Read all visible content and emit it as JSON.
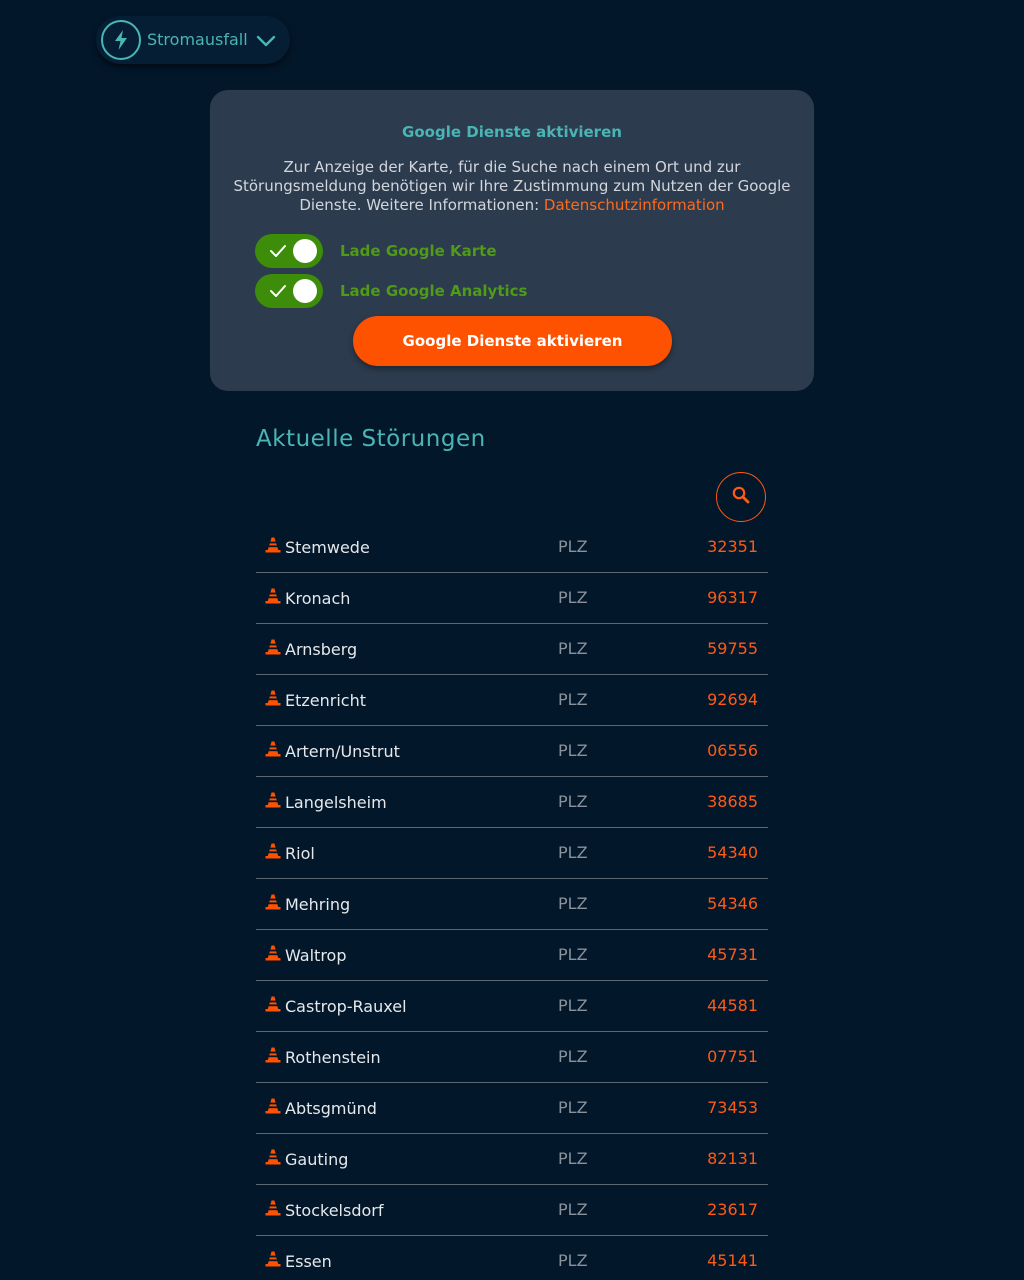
{
  "header": {
    "category_label": "Stromausfall",
    "category_icon": "lightning-bolt-icon",
    "dropdown_icon": "chevron-down-icon"
  },
  "consent": {
    "title": "Google Dienste aktivieren",
    "text": "Zur Anzeige der Karte, für die Suche nach einem Ort und zur Störungsmeldung benötigen wir Ihre Zustimmung zum Nutzen der Google Dienste. Weitere Informationen: ",
    "link_text": "Datenschutzinformation",
    "toggles": [
      {
        "label": "Lade Google Karte",
        "checked": true
      },
      {
        "label": "Lade Google Analytics",
        "checked": true
      }
    ],
    "button_label": "Google Dienste aktivieren"
  },
  "outages": {
    "title": "Aktuelle Störungen",
    "search_icon": "search-icon",
    "plz_label": "PLZ",
    "items": [
      {
        "town": "Stemwede",
        "plz": "32351"
      },
      {
        "town": "Kronach",
        "plz": "96317"
      },
      {
        "town": "Arnsberg",
        "plz": "59755"
      },
      {
        "town": "Etzenricht",
        "plz": "92694"
      },
      {
        "town": "Artern/Unstrut",
        "plz": "06556"
      },
      {
        "town": "Langelsheim",
        "plz": "38685"
      },
      {
        "town": "Riol",
        "plz": "54340"
      },
      {
        "town": "Mehring",
        "plz": "54346"
      },
      {
        "town": "Waltrop",
        "plz": "45731"
      },
      {
        "town": "Castrop-Rauxel",
        "plz": "44581"
      },
      {
        "town": "Rothenstein",
        "plz": "07751"
      },
      {
        "town": "Abtsgmünd",
        "plz": "73453"
      },
      {
        "town": "Gauting",
        "plz": "82131"
      },
      {
        "town": "Stockelsdorf",
        "plz": "23617"
      },
      {
        "town": "Essen",
        "plz": "45141"
      }
    ]
  },
  "colors": {
    "background": "#03172a",
    "card": "#2c3b4d",
    "accent_teal": "#4ab5b5",
    "accent_orange": "#ff5200",
    "toggle_green": "#3d8c0a"
  }
}
